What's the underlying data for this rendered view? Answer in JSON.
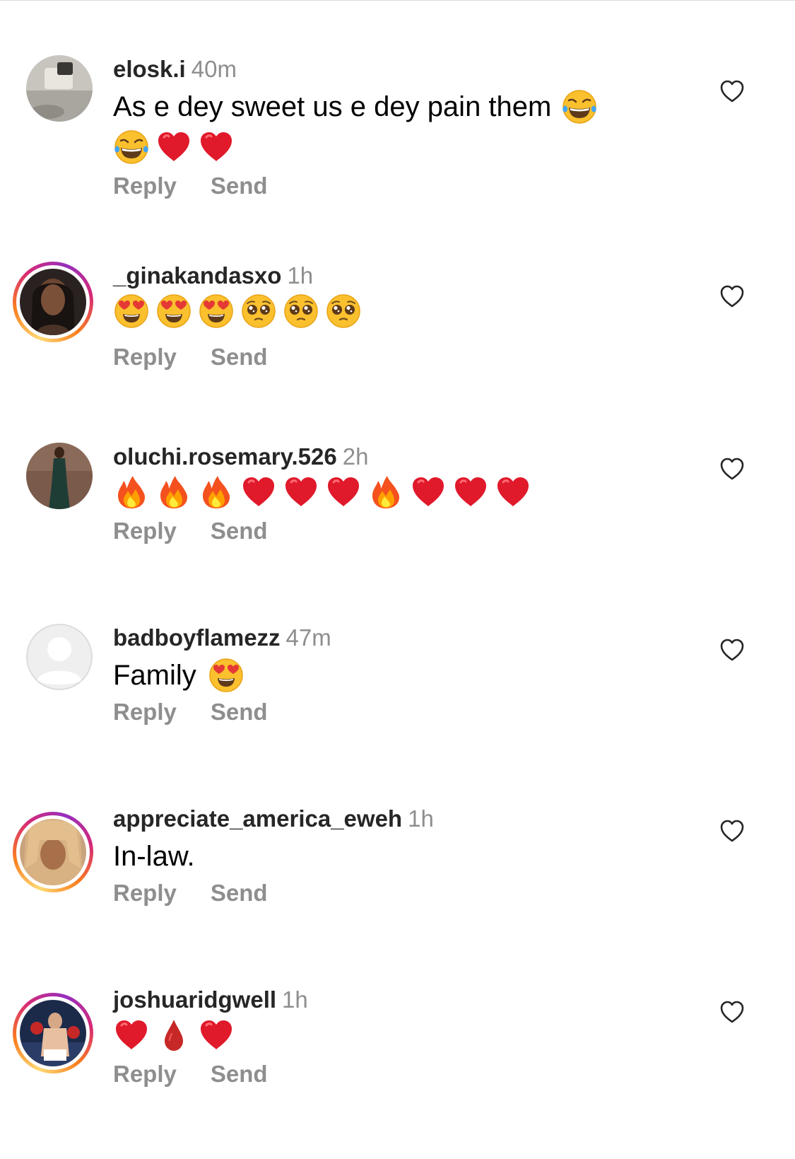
{
  "comments": [
    {
      "username": "elosk.i",
      "time": "40m",
      "text": "As e dey sweet us e dey pain them",
      "emojis_inline": [
        "laughing-tears"
      ],
      "emojis_line2": [
        "laughing-tears",
        "red-heart",
        "red-heart"
      ],
      "reply": "Reply",
      "send": "Send",
      "has_story_ring": false
    },
    {
      "username": "_ginakandasxo",
      "time": "1h",
      "emojis": [
        "heart-eyes",
        "heart-eyes",
        "heart-eyes",
        "pleading",
        "pleading",
        "pleading"
      ],
      "reply": "Reply",
      "send": "Send",
      "has_story_ring": true
    },
    {
      "username": "oluchi.rosemary.526",
      "time": "2h",
      "emojis": [
        "fire",
        "fire",
        "fire",
        "red-heart",
        "red-heart",
        "red-heart",
        "fire",
        "red-heart",
        "red-heart",
        "red-heart"
      ],
      "reply": "Reply",
      "send": "Send",
      "has_story_ring": false
    },
    {
      "username": "badboyflamezz",
      "time": "47m",
      "text": "Family",
      "emojis_inline": [
        "heart-eyes"
      ],
      "reply": "Reply",
      "send": "Send",
      "has_story_ring": false,
      "default_avatar": true
    },
    {
      "username": "appreciate_america_eweh",
      "time": "1h",
      "text": "In-law.",
      "reply": "Reply",
      "send": "Send",
      "has_story_ring": true
    },
    {
      "username": "joshuaridgwell",
      "time": "1h",
      "emojis": [
        "red-heart",
        "drop-of-blood",
        "red-heart"
      ],
      "reply": "Reply",
      "send": "Send",
      "has_story_ring": true
    }
  ],
  "colors": {
    "username": "#262626",
    "meta": "#8e8e8e",
    "heart_emoji": "#e0192b"
  }
}
